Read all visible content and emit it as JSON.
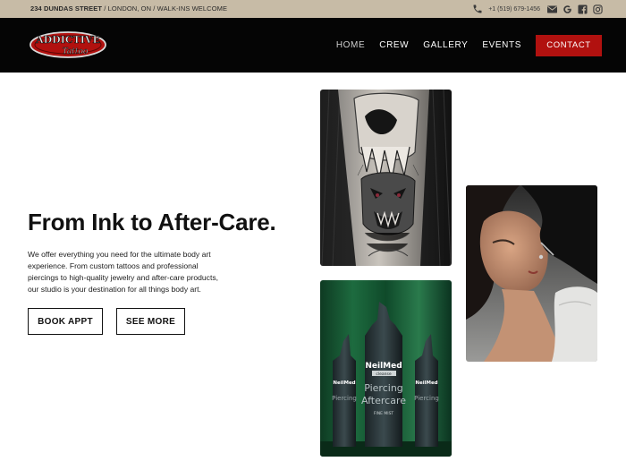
{
  "topbar": {
    "address_bold": "234 DUNDAS STREET",
    "address_rest": " / LONDON, ON / WALK-INS WELCOME",
    "phone": "+1 (519) 679-1456",
    "icons": [
      "phone-icon",
      "mail-icon",
      "google-icon",
      "facebook-icon",
      "instagram-icon"
    ]
  },
  "brand": {
    "logo_line1": "ADDICTIVE",
    "logo_line2": "Tattoo"
  },
  "nav": {
    "items": [
      {
        "label": "HOME",
        "active": true
      },
      {
        "label": "CREW"
      },
      {
        "label": "GALLERY"
      },
      {
        "label": "EVENTS"
      }
    ],
    "contact_label": "CONTACT"
  },
  "hero": {
    "title": "From Ink to After-Care.",
    "body": "We offer everything you need for the ultimate body art experience. From custom tattoos and professional piercings to high-quality jewelry and after-care products, our studio is your destination for all things body art.",
    "book_label": "BOOK APPT",
    "more_label": "SEE MORE"
  },
  "product": {
    "brand": "NeilMed",
    "sub": "cleanse",
    "line1": "Piercing",
    "line2": "Aftercare",
    "line3": "FINE MIST"
  },
  "colors": {
    "topbar": "#c7bba6",
    "header": "#050505",
    "accent": "#b1110f"
  }
}
